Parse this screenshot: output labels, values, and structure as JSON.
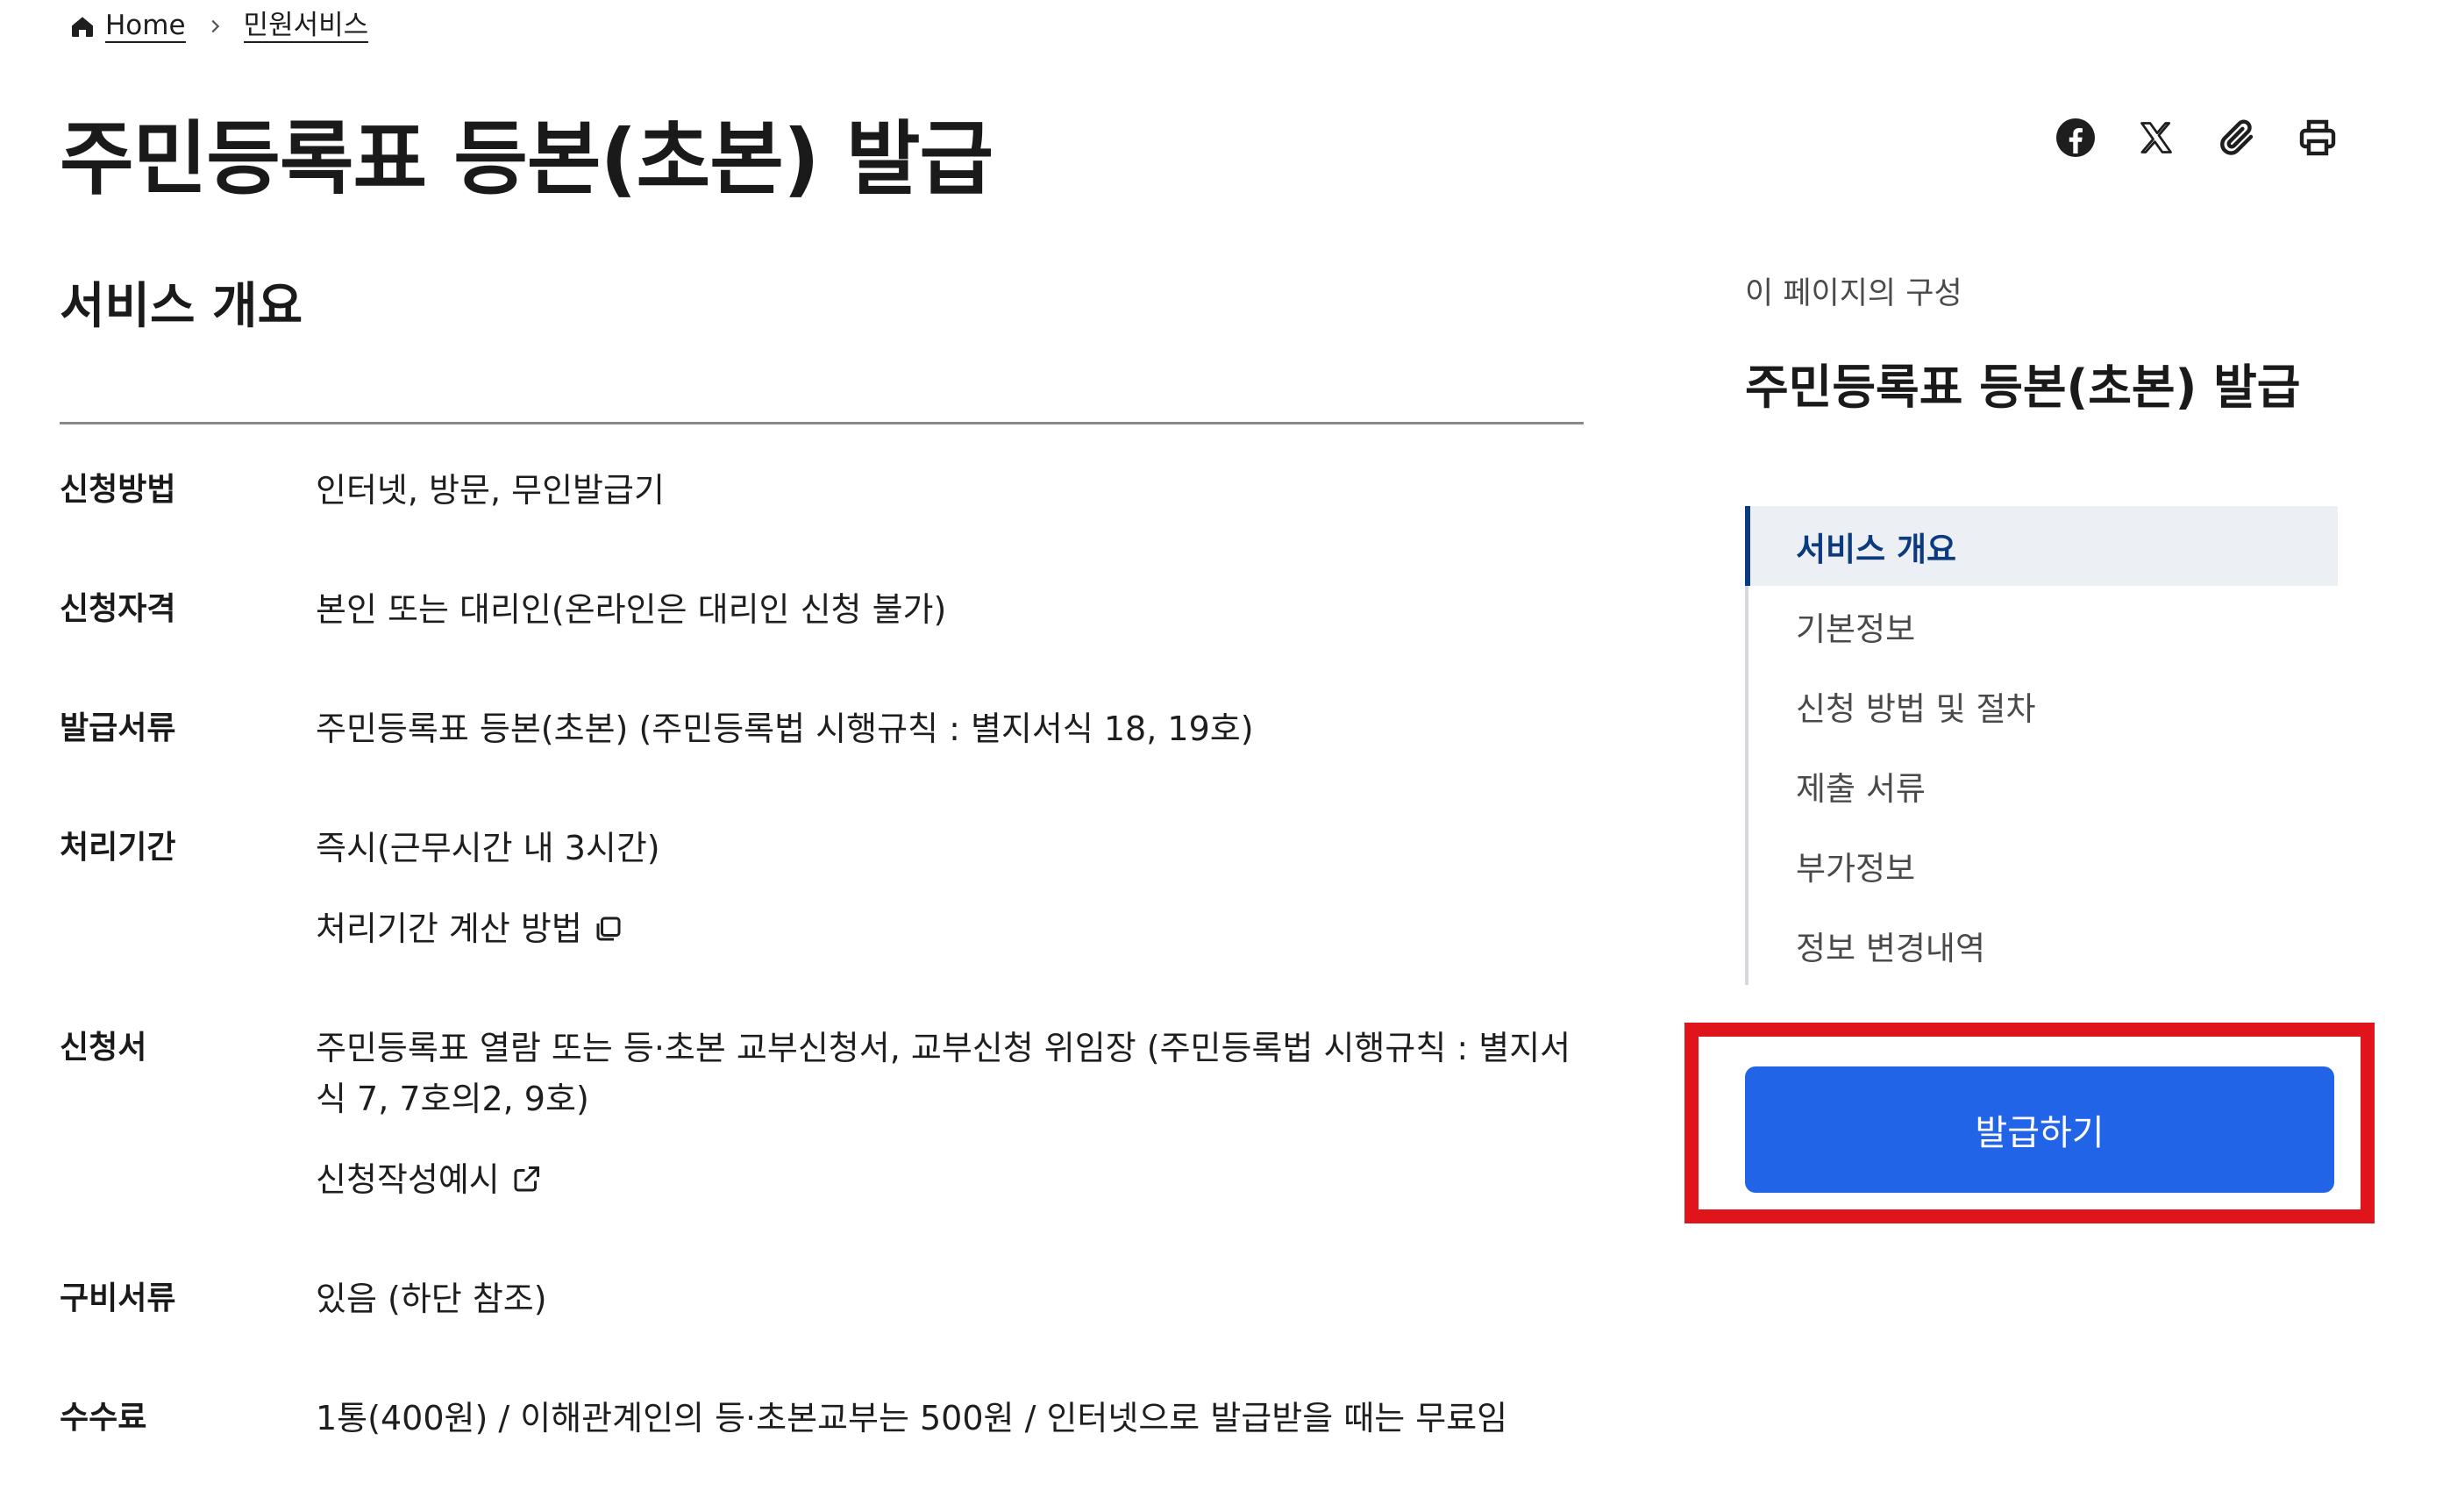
{
  "breadcrumb": {
    "home": "Home",
    "current": "민원서비스"
  },
  "page": {
    "title": "주민등록표 등본(초본) 발급"
  },
  "share": {
    "icons": [
      "facebook-icon",
      "x-icon",
      "paperclip-icon",
      "print-icon"
    ]
  },
  "overview": {
    "section_title": "서비스 개요",
    "rows": [
      {
        "label": "신청방법",
        "value": "인터넷, 방문, 무인발급기"
      },
      {
        "label": "신청자격",
        "value": "본인 또는 대리인(온라인은 대리인 신청 불가)"
      },
      {
        "label": "발급서류",
        "value": "주민등록표 등본(초본) (주민등록법 시행규칙 : 별지서식 18, 19호)"
      },
      {
        "label": "처리기간",
        "value": "즉시(근무시간 내 3시간)",
        "link": "처리기간 계산 방법"
      },
      {
        "label": "신청서",
        "value": "주민등록표 열람 또는 등·초본 교부신청서, 교부신청 위임장 (주민등록법 시행규칙 : 별지서식 7, 7호의2, 9호)",
        "link": "신청작성예시"
      },
      {
        "label": "구비서류",
        "value": "있음 (하단 참조)"
      },
      {
        "label": "수수료",
        "value": "1통(400원) / 이해관계인의 등·초본교부는 500원 / 인터넷으로 발급받을 때는 무료임"
      }
    ]
  },
  "toc": {
    "caption": "이 페이지의 구성",
    "title": "주민등록표 등본(초본) 발급",
    "items": [
      {
        "label": "서비스 개요",
        "active": true
      },
      {
        "label": "기본정보",
        "active": false
      },
      {
        "label": "신청 방법 및 절차",
        "active": false
      },
      {
        "label": "제출 서류",
        "active": false
      },
      {
        "label": "부가정보",
        "active": false
      },
      {
        "label": "정보 변경내역",
        "active": false
      }
    ]
  },
  "actions": {
    "issue_label": "발급하기"
  },
  "colors": {
    "primary_button": "#2164e8",
    "toc_active": "#0b3a7e",
    "highlight_frame": "#e0141b"
  }
}
